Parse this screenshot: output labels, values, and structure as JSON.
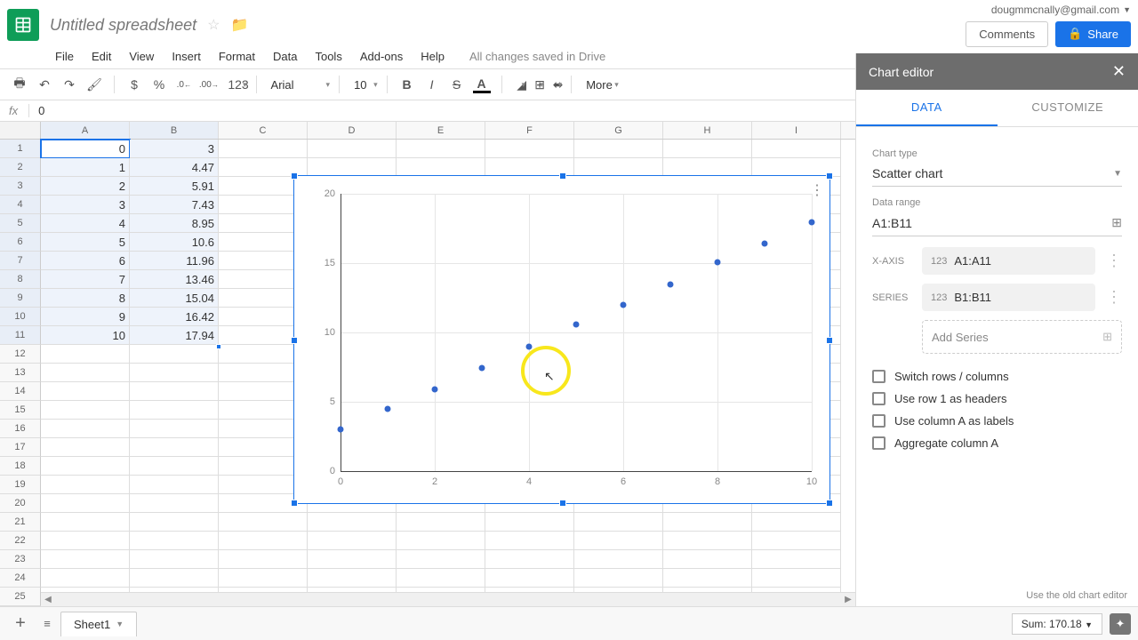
{
  "doc_title": "Untitled spreadsheet",
  "user_email": "dougmmcnally@gmail.com",
  "comments_label": "Comments",
  "share_label": "Share",
  "menu": [
    "File",
    "Edit",
    "View",
    "Insert",
    "Format",
    "Data",
    "Tools",
    "Add-ons",
    "Help"
  ],
  "saved_text": "All changes saved in Drive",
  "toolbar": {
    "currency": "$",
    "percent": "%",
    "dec_dec": ".0",
    "inc_dec": ".00",
    "num_fmt": "123",
    "font": "Arial",
    "size": "10",
    "more": "More"
  },
  "fx_value": "0",
  "columns": [
    "A",
    "B",
    "C",
    "D",
    "E",
    "F",
    "G",
    "H",
    "I"
  ],
  "row_count": 25,
  "table": {
    "a": [
      0,
      1,
      2,
      3,
      4,
      5,
      6,
      7,
      8,
      9,
      10
    ],
    "b": [
      3,
      4.47,
      5.91,
      7.43,
      8.95,
      10.6,
      11.96,
      13.46,
      15.04,
      16.42,
      17.94
    ]
  },
  "chart_data": {
    "type": "scatter",
    "x": [
      0,
      1,
      2,
      3,
      4,
      5,
      6,
      7,
      8,
      9,
      10
    ],
    "y": [
      3,
      4.47,
      5.91,
      7.43,
      8.95,
      10.6,
      11.96,
      13.46,
      15.04,
      16.42,
      17.94
    ],
    "xlim": [
      0,
      10
    ],
    "ylim": [
      0,
      20
    ],
    "x_ticks": [
      0,
      2,
      4,
      6,
      8,
      10
    ],
    "y_ticks": [
      0,
      5,
      10,
      15,
      20
    ],
    "title": "",
    "xlabel": "",
    "ylabel": ""
  },
  "chart_editor": {
    "title": "Chart editor",
    "tab_data": "DATA",
    "tab_customize": "CUSTOMIZE",
    "chart_type_label": "Chart type",
    "chart_type": "Scatter chart",
    "data_range_label": "Data range",
    "data_range": "A1:B11",
    "xaxis_label": "X-AXIS",
    "xaxis_value": "A1:A11",
    "series_label": "SERIES",
    "series_value": "B1:B11",
    "add_series": "Add Series",
    "check1": "Switch rows / columns",
    "check2": "Use row 1 as headers",
    "check3": "Use column A as labels",
    "check4": "Aggregate column A",
    "old_editor": "Use the old chart editor"
  },
  "sheet_tab": "Sheet1",
  "sum_text": "Sum: 170.18",
  "num_prefix": "123"
}
